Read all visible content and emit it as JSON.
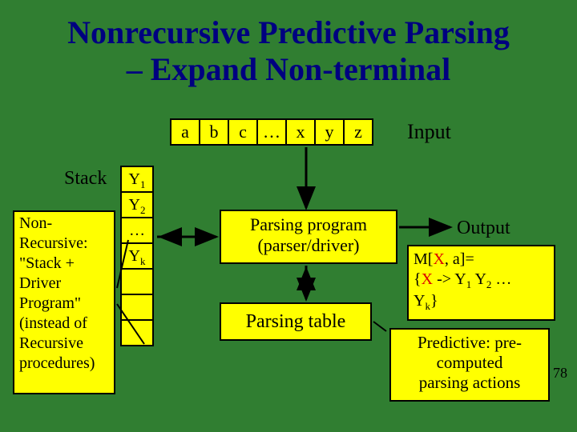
{
  "title_line1": "Nonrecursive Predictive Parsing",
  "title_line2": "– Expand Non-terminal",
  "input": {
    "cells": [
      "a",
      "b",
      "c",
      "…",
      "x",
      "y",
      "z"
    ],
    "label": "Input"
  },
  "stack": {
    "label": "Stack",
    "cells_html": [
      "Y<span class='sub'>1</span>",
      "Y<span class='sub'>2</span>",
      "…",
      "Y<span class='sub'>k</span>",
      "",
      "",
      ""
    ]
  },
  "parsing_program": {
    "line1": "Parsing program",
    "line2": "(parser/driver)"
  },
  "parsing_table": "Parsing table",
  "output_label": "Output",
  "mxa": {
    "line1_pre": "M[",
    "line1_x": "X",
    "line1_post": ", a]=",
    "line2_pre": "{",
    "line2_x": "X",
    "line2_post": " -> Y",
    "line2_tail": " Y",
    "line2_end": " …",
    "line3": "Y",
    "line3_end": "}"
  },
  "predictive": {
    "l1": "Predictive: pre-",
    "l2": "computed",
    "l3": "parsing actions"
  },
  "nonrec": {
    "l1": "Non-",
    "l2": "Recursive:",
    "l3": "\"Stack +",
    "l4": "Driver",
    "l5": "Program\"",
    "l6": "(instead of",
    "l7": "Recursive",
    "l8": "procedures)"
  },
  "slide_num": "78"
}
